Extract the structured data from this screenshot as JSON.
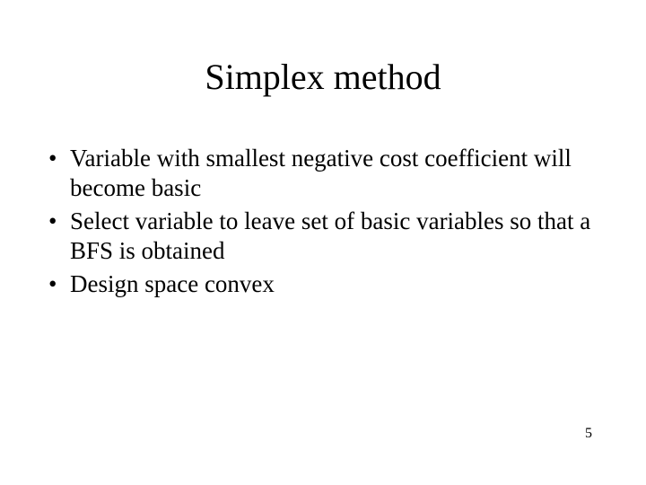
{
  "slide": {
    "title": "Simplex method",
    "bullets": [
      "Variable with smallest negative cost coefficient will become basic",
      "Select variable to leave set of basic variables so that a BFS is obtained",
      "Design space convex"
    ],
    "page_number": "5"
  }
}
